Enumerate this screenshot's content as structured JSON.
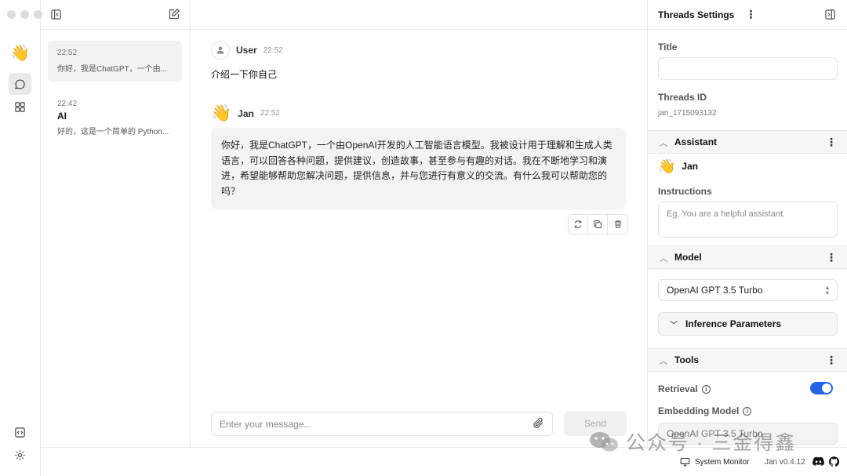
{
  "rail": {
    "assistant_icon": "waving-hand-icon",
    "items": [
      "chat-icon",
      "grid-icon"
    ],
    "bottom": [
      "code-icon",
      "gear-icon"
    ]
  },
  "threads": [
    {
      "time": "22:52",
      "title": "",
      "snippet": "你好，我是ChatGPT，一个由..."
    },
    {
      "time": "22:42",
      "title": "AI",
      "snippet": "好的，这是一个简单的 Python..."
    }
  ],
  "chat": {
    "user": {
      "name": "User",
      "time": "22:52",
      "text": "介绍一下你自己"
    },
    "assistant": {
      "name": "Jan",
      "time": "22:52",
      "text": "你好，我是ChatGPT，一个由OpenAI开发的人工智能语言模型。我被设计用于理解和生成人类语言，可以回答各种问题，提供建议，创造故事，甚至参与有趣的对话。我在不断地学习和演进，希望能够帮助您解决问题，提供信息，并与您进行有意义的交流。有什么我可以帮助您的吗？"
    },
    "input_placeholder": "Enter your message...",
    "send_label": "Send"
  },
  "settings": {
    "header": "Threads Settings",
    "title_label": "Title",
    "title_value": "",
    "thread_id_label": "Threads ID",
    "thread_id_value": "jan_1715093132",
    "assistant_section": "Assistant",
    "assistant_name": "Jan",
    "instructions_label": "Instructions",
    "instructions_placeholder": "Eg. You are a helpful assistant.",
    "model_section": "Model",
    "model_value": "OpenAI GPT 3.5 Turbo",
    "inference_label": "Inference Parameters",
    "tools_section": "Tools",
    "retrieval_label": "Retrieval",
    "retrieval_enabled": true,
    "embedding_label": "Embedding Model",
    "embedding_value": "OpenAI GPT 3.5 Turbo"
  },
  "status": {
    "system_monitor": "System Monitor",
    "version": "Jan v0.4.12"
  },
  "watermark": "公众号 · 三金得鑫",
  "colors": {
    "accent": "#2563eb",
    "border": "#e8e8e8",
    "bubble": "#f3f3f3"
  }
}
